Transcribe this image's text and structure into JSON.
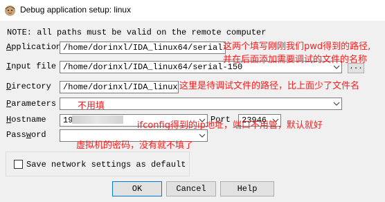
{
  "window": {
    "title": "Debug application setup: linux",
    "icon": "ida-app-icon"
  },
  "note": "NOTE: all paths must be valid on the remote computer",
  "fields": {
    "application": {
      "label": "Application",
      "value": "/home/dorinxl/IDA_linux64/serial-150"
    },
    "input_file": {
      "label": "Input file",
      "value": "/home/dorinxl/IDA_linux64/serial-150"
    },
    "directory": {
      "label": "Directory",
      "value": "/home/dorinxl/IDA_linux64"
    },
    "parameters": {
      "label": "Parameters",
      "value": ""
    },
    "hostname": {
      "label": "Hostname",
      "value": "19"
    },
    "port": {
      "label": "Port",
      "value": "23946"
    },
    "password": {
      "label": "Password",
      "value": ""
    }
  },
  "browse_label": "...",
  "save_settings_label": "Save network settings as default",
  "save_settings_checked": false,
  "buttons": {
    "ok": "OK",
    "cancel": "Cancel",
    "help": "Help"
  },
  "annotations": {
    "app_line1": "这两个填写刚刚我们pwd得到的路径,",
    "app_line2": "并在后面添加需要调试的文件的名称",
    "directory": "这里是待调试文件的路径，比上面少了文件名",
    "parameters": "不用填",
    "hostname": "ifconfig得到的ip地址，端口不用管，默认就好",
    "password": "虚拟机的密码，没有就不填了"
  },
  "colors": {
    "annotation": "#ff1a1a",
    "dialog_bg": "#f0f0f0",
    "default_button_border": "#0078d7"
  }
}
